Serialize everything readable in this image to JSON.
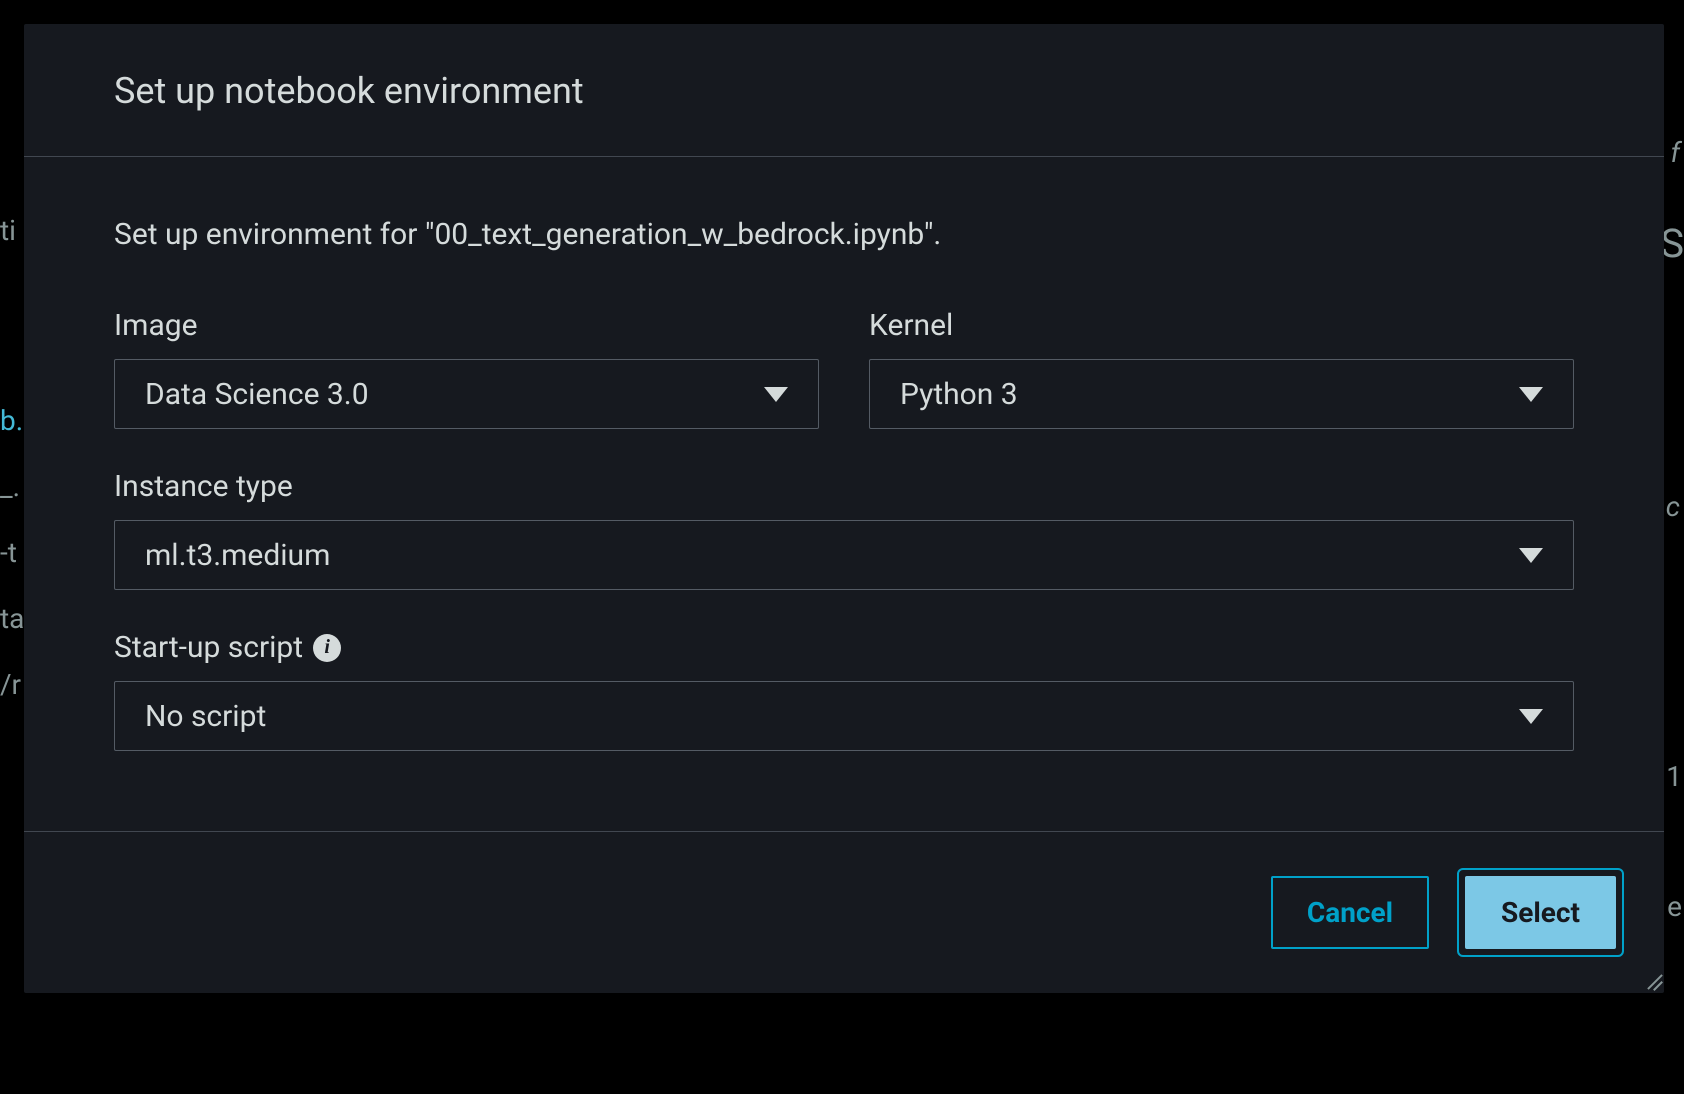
{
  "modal": {
    "title": "Set up notebook environment",
    "subtitle": "Set up environment for \"00_text_generation_w_bedrock.ipynb\".",
    "fields": {
      "image": {
        "label": "Image",
        "value": "Data Science 3.0"
      },
      "kernel": {
        "label": "Kernel",
        "value": "Python 3"
      },
      "instance_type": {
        "label": "Instance type",
        "value": "ml.t3.medium"
      },
      "startup_script": {
        "label": "Start-up script",
        "value": "No script"
      }
    },
    "buttons": {
      "cancel": "Cancel",
      "select": "Select"
    }
  },
  "background_fragments": {
    "ti": "ti",
    "b": "b.",
    "l": "_.",
    "t": "-t",
    "ta": "ta",
    "yr": "/r",
    "f": "f",
    "s": "S",
    "c": "c",
    "one": "1",
    "e": "e"
  }
}
